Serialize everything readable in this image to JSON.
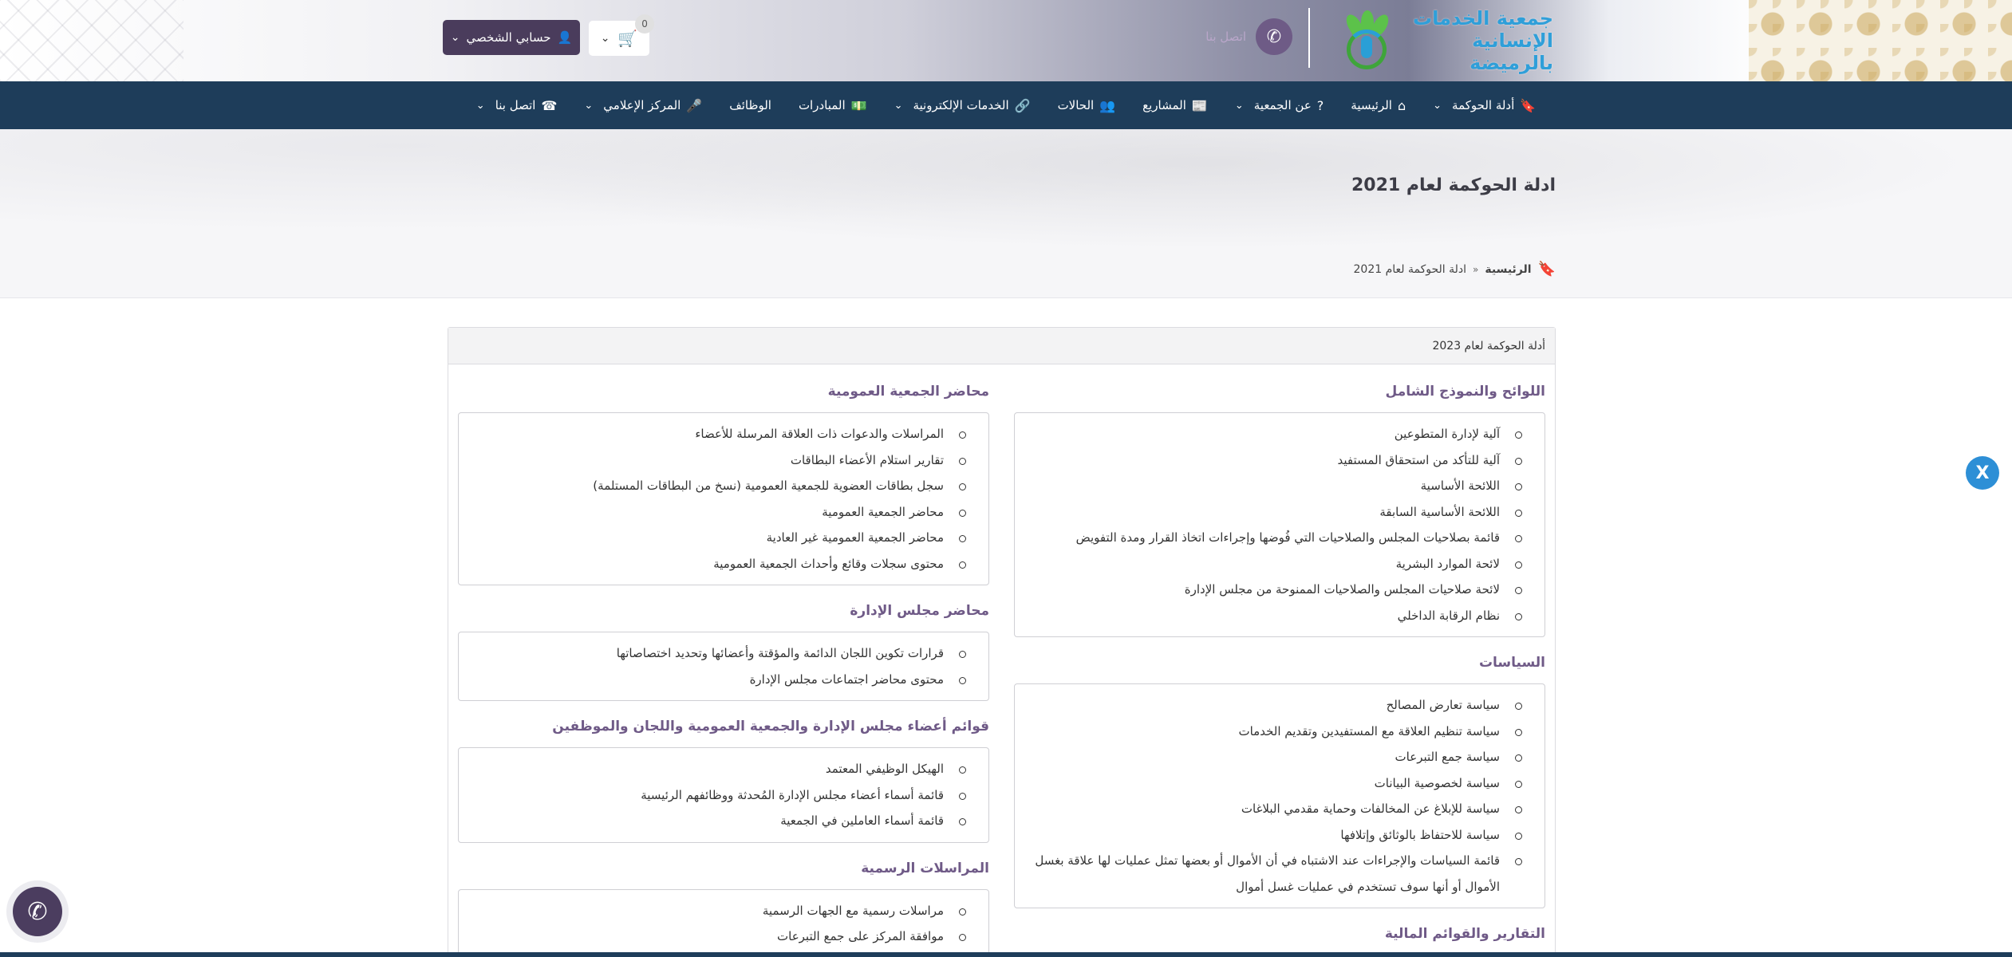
{
  "header": {
    "logo_line1": "جمعية الخدمات",
    "logo_line2": "الإنسانية بالرميضة",
    "phone_label": "اتصل بنا",
    "cart_count": "0",
    "account_label": "حسابي الشخصي"
  },
  "nav": {
    "items": [
      {
        "label": "أدلة الحوكمة",
        "icon": "bookmark-icon",
        "dropdown": true
      },
      {
        "label": "الرئيسية",
        "icon": "home-icon",
        "dropdown": false
      },
      {
        "label": "عن الجمعية",
        "icon": "question-icon",
        "dropdown": true
      },
      {
        "label": "المشاريع",
        "icon": "newspaper-icon",
        "dropdown": false
      },
      {
        "label": "الحالات",
        "icon": "users-icon",
        "dropdown": false
      },
      {
        "label": "الخدمات الإلكترونية",
        "icon": "link-icon",
        "dropdown": true
      },
      {
        "label": "المبادرات",
        "icon": "money-icon",
        "dropdown": false
      },
      {
        "label": "الوظائف",
        "icon": "",
        "dropdown": false
      },
      {
        "label": "المركز الإعلامي",
        "icon": "microphone-icon",
        "dropdown": true
      },
      {
        "label": "اتصل بنا",
        "icon": "phone-icon",
        "dropdown": true
      }
    ]
  },
  "page": {
    "title": "ادلة الحوكمة لعام 2021",
    "breadcrumb_home": "الرئيسية",
    "breadcrumb_current": "ادلة الحوكمة لعام 2021"
  },
  "card": {
    "header": "أدلة الحوكمة لعام 2023",
    "right_sections": [
      {
        "title": "اللوائح والنموذج الشامل",
        "items": [
          "آلية لإدارة المتطوعين",
          "آلية للتأكد من استحقاق المستفيد",
          "اللائحة الأساسية",
          "اللائحة الأساسية السابقة",
          "قائمة بصلاحيات المجلس والصلاحيات التي فُوضها وإجراءات اتخاذ القرار ومدة التفويض",
          "لائحة الموارد البشرية",
          "لائحة صلاحيات المجلس والصلاحيات الممنوحة من مجلس الإدارة",
          "نظام الرقابة الداخلي"
        ]
      },
      {
        "title": "السياسات",
        "items": [
          "سياسة تعارض المصالح",
          "سياسة تنظيم العلاقة مع المستفيدين وتقديم الخدمات",
          "سياسة جمع التبرعات",
          "سياسة لخصوصية البيانات",
          "سياسة للإبلاغ عن المخالفات وحماية مقدمي البلاغات",
          "سياسة للاحتفاظ بالوثائق وإتلافها",
          "قائمة السياسات والإجراءات عند الاشتباه في أن الأموال أو بعضها تمثل عمليات لها علاقة بغسل الأموال أو أنها سوف تستخدم في عمليات غسل أموال"
        ]
      },
      {
        "title": "التقارير والقوائم المالية",
        "items": []
      }
    ],
    "left_sections": [
      {
        "title": "محاضر الجمعية العمومية",
        "items": [
          "المراسلات والدعوات ذات العلاقة المرسلة للأعضاء",
          "تقارير استلام الأعضاء البطاقات",
          "سجل بطاقات العضوية للجمعية العمومية (نسخ من البطاقات المستلمة)",
          "محاضر الجمعية العمومية",
          "محاضر الجمعية العمومية غير العادية",
          "محتوى سجلات وقائع وأحداث الجمعية العمومية"
        ]
      },
      {
        "title": "محاضر مجلس الإدارة",
        "items": [
          "قرارات تكوين اللجان الدائمة والمؤقتة وأعضائها وتحديد اختصاصاتها",
          "محتوى محاضر اجتماعات مجلس الإدارة"
        ]
      },
      {
        "title": "قوائم أعضاء مجلس الإدارة والجمعية العمومية واللجان والموظفين",
        "items": [
          "الهيكل الوظيفي المعتمد",
          "قائمة أسماء أعضاء مجلس الإدارة المُحدثة ووظائفهم الرئيسية",
          "قائمة أسماء العاملين في الجمعية"
        ]
      },
      {
        "title": "المراسلات الرسمية",
        "items": [
          "مراسلات رسمية مع الجهات الرسمية",
          "موافقة المركز على جمع التبرعات"
        ]
      }
    ]
  },
  "floating": {
    "x_label": "X",
    "whatsapp_icon": "whatsapp-icon"
  },
  "colors": {
    "nav_bg": "#1e3d5a",
    "section_title": "#6f5a87",
    "account_btn": "#4a3c5c",
    "x_btn": "#2d8fd6"
  }
}
